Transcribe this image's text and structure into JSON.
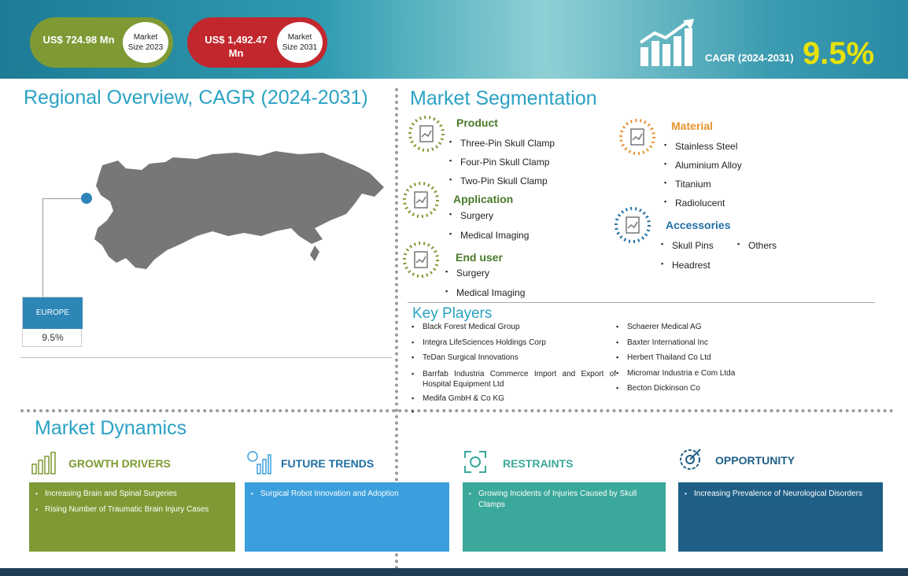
{
  "header": {
    "size_2023": {
      "value": "US$ 724.98 Mn",
      "label": "Market Size 2023"
    },
    "size_2031": {
      "value": "US$ 1,492.47 Mn",
      "label": "Market Size 2031"
    },
    "cagr_label": "CAGR (2024-2031)",
    "cagr_value": "9.5%"
  },
  "regional": {
    "title": "Regional Overview, CAGR (2024-2031)",
    "region_label": "EUROPE",
    "region_value": "9.5%"
  },
  "segmentation": {
    "title": "Market Segmentation",
    "product": {
      "head": "Product",
      "items": [
        "Three-Pin Skull Clamp",
        "Four-Pin Skull Clamp",
        "Two-Pin Skull Clamp"
      ]
    },
    "application": {
      "head": "Application",
      "items": [
        "Surgery",
        "Medical Imaging"
      ]
    },
    "end_user": {
      "head": "End user",
      "items": [
        "Surgery",
        "Medical Imaging"
      ]
    },
    "material": {
      "head": "Material",
      "items": [
        "Stainless Steel",
        "Aluminium Alloy",
        "Titanium",
        "Radiolucent"
      ]
    },
    "accessories": {
      "head": "Accessories",
      "items": [
        "Skull Pins",
        "Others",
        "Headrest"
      ]
    }
  },
  "key_players": {
    "title": "Key Players",
    "left": [
      "Black Forest Medical Group",
      "Integra LifeSciences Holdings Corp",
      "TeDan Surgical Innovations",
      "Barrfab Industria Commerce Import and Export of Hospital Equipment Ltd",
      "Medifa GmbH & Co KG",
      ""
    ],
    "right": [
      "Schaerer Medical AG",
      "Baxter International Inc",
      "Herbert Thailand Co Ltd",
      "Micromar Industria e Com Ltda",
      "Becton Dickinson Co"
    ]
  },
  "dynamics": {
    "title": "Market Dynamics",
    "growth": {
      "head": "GROWTH DRIVERS",
      "items": [
        "Increasing Brain and Spinal Surgeries",
        "Rising Number of Traumatic Brain Injury Cases"
      ]
    },
    "trends": {
      "head": "FUTURE TRENDS",
      "items": [
        "Surgical Robot Innovation and Adoption"
      ]
    },
    "restraints": {
      "head": "RESTRAINTS",
      "items": [
        "Growing Incidents of Injuries Caused by Skull Clamps"
      ]
    },
    "opportunity": {
      "head": "OPPORTUNITY",
      "items": [
        "Increasing Prevalence of Neurological Disorders"
      ]
    }
  },
  "colors": {
    "accent_blue": "#2aa2c4",
    "green": "#7f9a34",
    "red": "#c1272d",
    "orange": "#e8932e",
    "teal": "#3aa89a",
    "sky": "#3a9fdc",
    "navy": "#1f5f86",
    "cagr_yellow": "#e8e20a"
  }
}
